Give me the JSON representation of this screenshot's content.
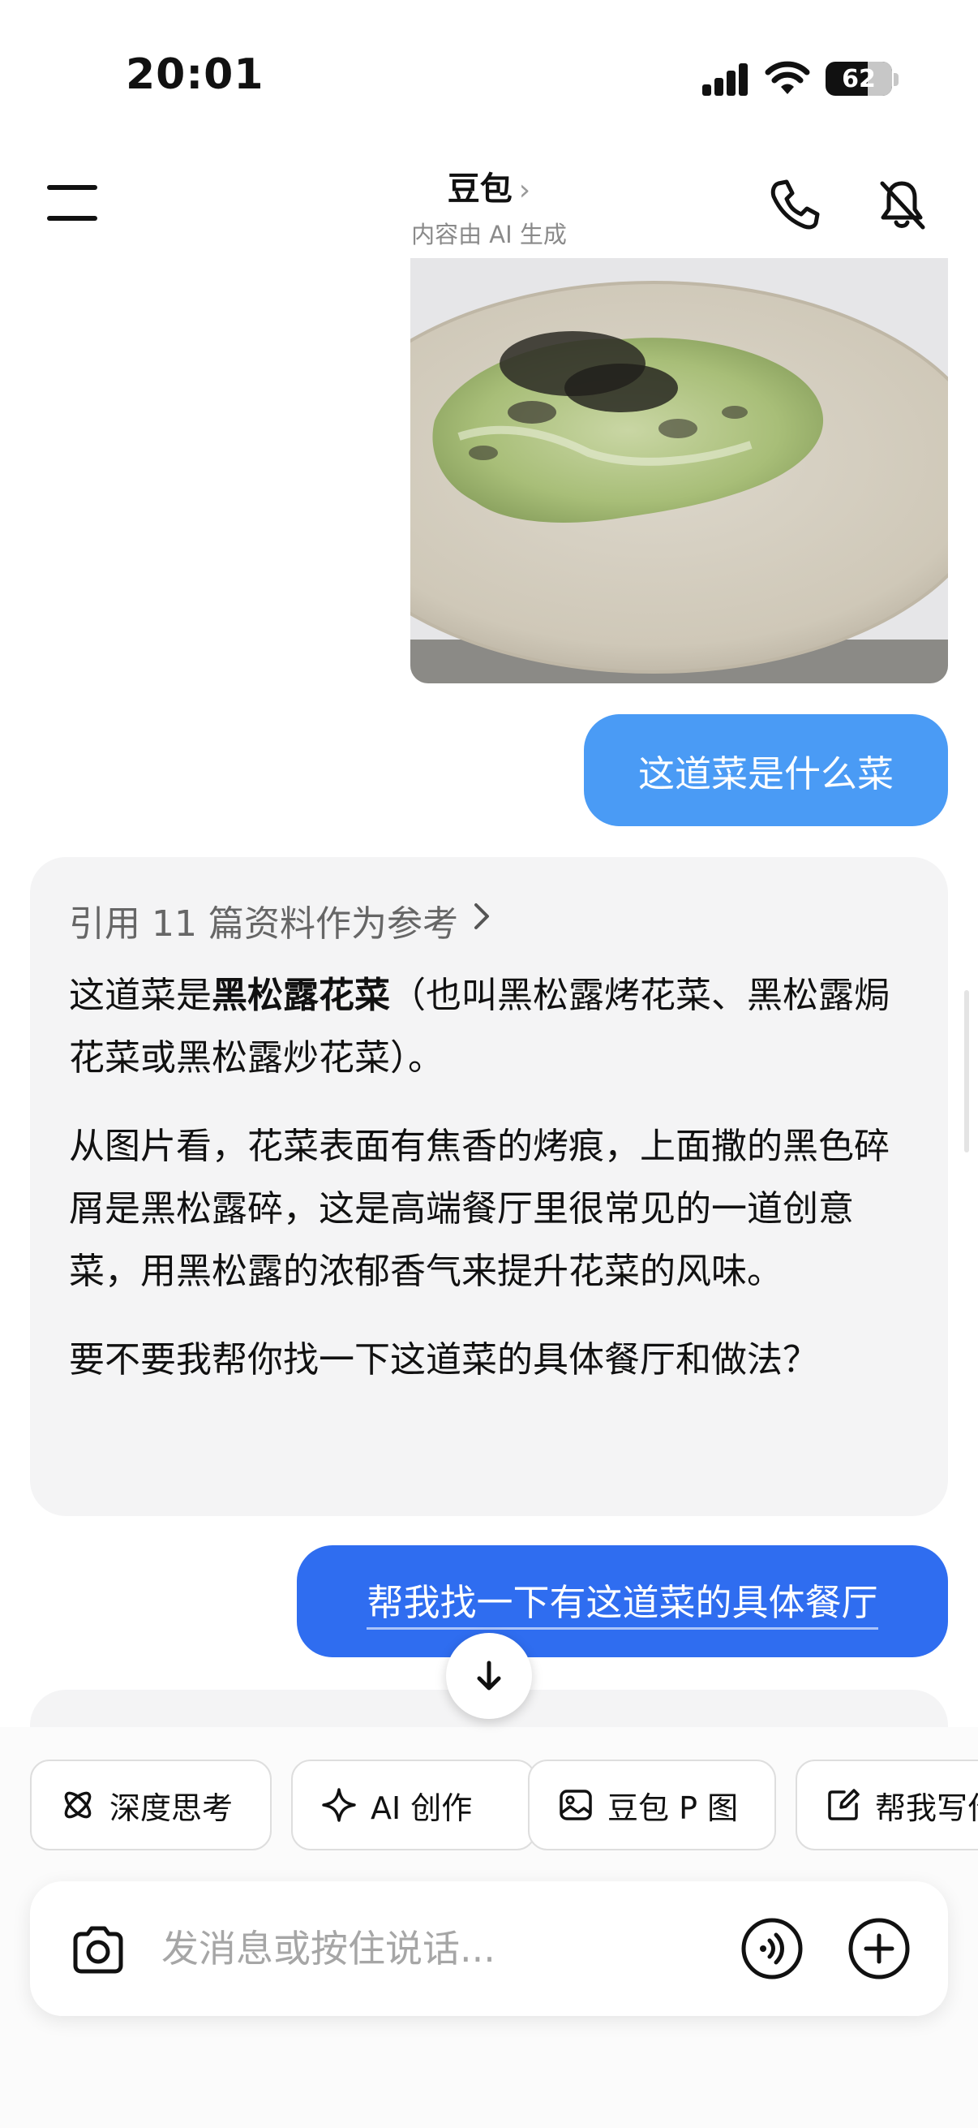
{
  "status": {
    "time": "20:01",
    "battery": "62"
  },
  "header": {
    "title": "豆包",
    "chevron": "›",
    "subtitle": "内容由 AI 生成"
  },
  "icons": {
    "menu": "menu-icon",
    "phone": "phone-icon",
    "mute": "mute-icon",
    "scroll_down": "arrow-down-icon",
    "camera": "camera-icon",
    "voice": "voice-icon",
    "plus": "plus-icon"
  },
  "messages": {
    "user_1": "这道菜是什么菜",
    "bot_1": {
      "reference": "引用 11 篇资料作为参考",
      "p1_prefix": "这道菜是",
      "p1_bold": "黑松露花菜",
      "p1_suffix": "（也叫黑松露烤花菜、黑松露焗花菜或黑松露炒花菜）。",
      "p2": "从图片看，花菜表面有焦香的烤痕，上面撒的黑色碎屑是黑松露碎，这是高端餐厅里很常见的一道创意菜，用黑松露的浓郁香气来提升花菜的风味。",
      "p3": "要不要我帮你找一下这道菜的具体餐厅和做法？"
    },
    "user_2": "帮我找一下有这道菜的具体餐厅"
  },
  "chips": [
    {
      "label": "深度思考",
      "icon": "atom-icon"
    },
    {
      "label": "AI 创作",
      "icon": "sparkle-icon"
    },
    {
      "label": "豆包 P 图",
      "icon": "image-edit-icon"
    },
    {
      "label": "帮我写作",
      "icon": "write-icon"
    }
  ],
  "input": {
    "placeholder": "发消息或按住说话..."
  }
}
